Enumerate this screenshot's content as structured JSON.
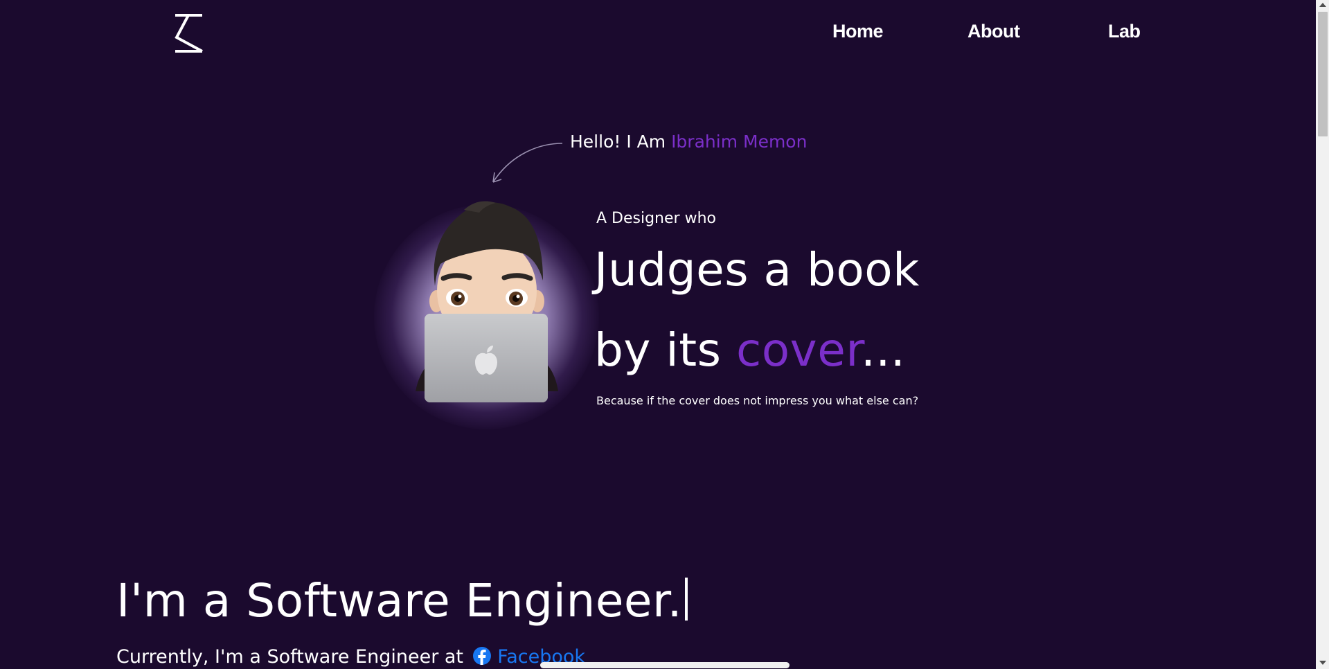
{
  "nav": {
    "logo_icon": "brand-logo-icon",
    "items": [
      {
        "label": "Home"
      },
      {
        "label": "About"
      },
      {
        "label": "Lab"
      }
    ]
  },
  "hero": {
    "greeting": "Hello! I Am ",
    "name": "Ibrahim Memon",
    "subtitle": "A Designer who",
    "headline_1": "Judges a book",
    "headline_2_prefix": "by its ",
    "headline_2_accent": "cover",
    "headline_2_suffix": "...",
    "tagline": "Because if the cover does not impress you what else can?",
    "avatar_icon": "memoji-laptop-avatar",
    "arrow_icon": "curved-arrow-icon"
  },
  "intro": {
    "title": "I'm a Software Engineer.",
    "current_prefix": "Currently, I'm a Software Engineer at ",
    "company": "Facebook",
    "company_icon": "facebook-icon"
  },
  "colors": {
    "background": "#1b0a2e",
    "accent": "#7b2fc9",
    "link": "#1877f2",
    "text": "#ffffff"
  }
}
